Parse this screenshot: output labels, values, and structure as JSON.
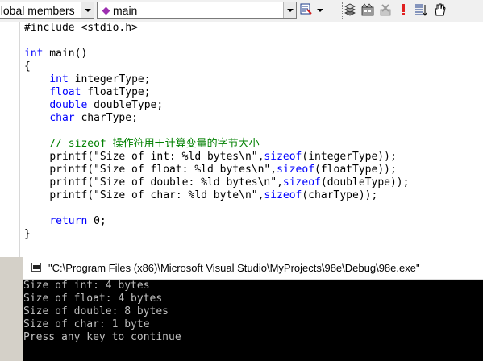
{
  "toolbar": {
    "scope_combo": {
      "value": "global members"
    },
    "function_combo": {
      "value": "main"
    },
    "icons": [
      "wizard-bar-icon",
      "compile-icon",
      "build-icon",
      "stop-build-icon",
      "execute-icon",
      "toggle-breakpoint-icon",
      "go-icon"
    ]
  },
  "colors": {
    "keyword": "#0000ff",
    "comment": "#008000",
    "toolbar": "#f0f0f0",
    "console_bg": "#000000",
    "console_text": "#c0c0c0"
  },
  "editor": {
    "lines": {
      "l1": "#include <stdio.h>",
      "l3_kw": "int",
      "l3_rest": " main()",
      "l4": "{",
      "l5_kw": "int",
      "l5_rest": " integerType;",
      "l6_kw": "float",
      "l6_rest": " floatType;",
      "l7_kw": "double",
      "l7_rest": " doubleType;",
      "l8_kw": "char",
      "l8_rest": " charType;",
      "l10_comment": "// sizeof 操作符用于计算变量的字节大小",
      "l11_a": "printf(\"Size of int: %ld bytes\\n\",",
      "l11_kw": "sizeof",
      "l11_b": "(integerType));",
      "l12_a": "printf(\"Size of float: %ld bytes\\n\",",
      "l12_kw": "sizeof",
      "l12_b": "(floatType));",
      "l13_a": "printf(\"Size of double: %ld bytes\\n\",",
      "l13_kw": "sizeof",
      "l13_b": "(doubleType));",
      "l14_a": "printf(\"Size of char: %ld byte\\n\",",
      "l14_kw": "sizeof",
      "l14_b": "(charType));",
      "l16_kw": "return",
      "l16_rest": " 0;",
      "l17": "}"
    }
  },
  "console": {
    "title": "\"C:\\Program Files (x86)\\Microsoft Visual Studio\\MyProjects\\98e\\Debug\\98e.exe\"",
    "lines": [
      "Size of int: 4 bytes",
      "Size of float: 4 bytes",
      "Size of double: 8 bytes",
      "Size of char: 1 byte",
      "Press any key to continue"
    ]
  }
}
